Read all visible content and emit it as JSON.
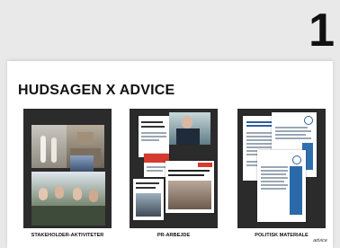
{
  "slide": {
    "number": "1"
  },
  "card": {
    "title": "HUDSAGEN X ADVICE",
    "brand": "advice"
  },
  "tiles": [
    {
      "label": "STAKEHOLDER-AKTIVITETER"
    },
    {
      "label": "PR-ARBEJDE"
    },
    {
      "label": "POLITISK MATERIALE"
    }
  ]
}
